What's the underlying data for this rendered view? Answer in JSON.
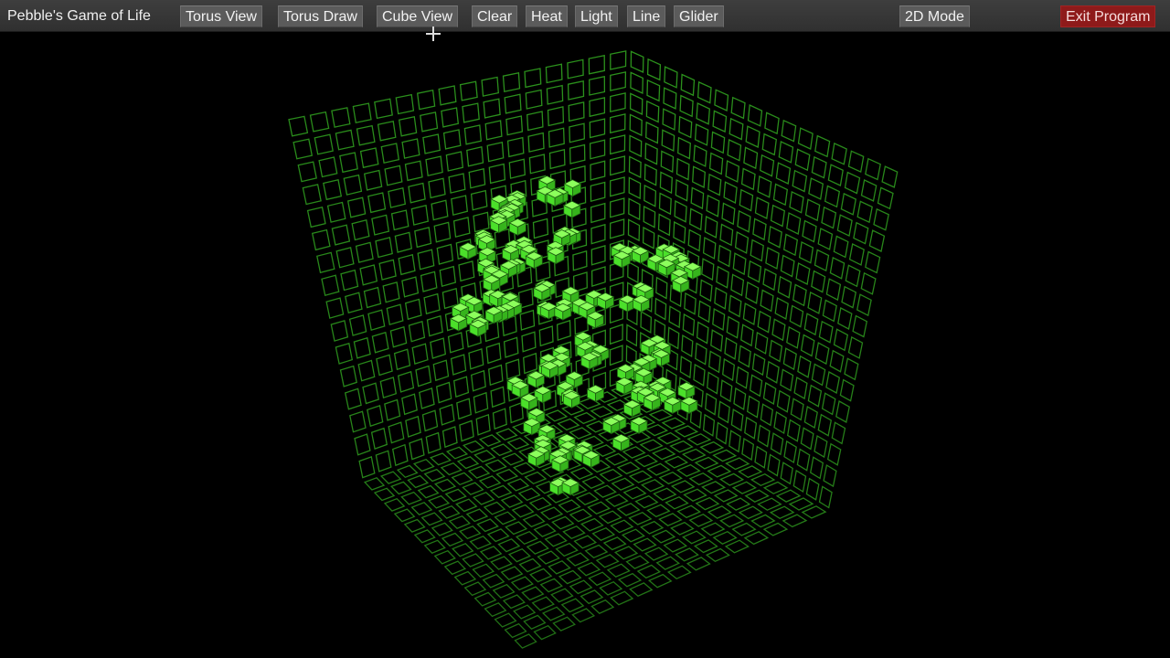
{
  "app": {
    "title": "Pebble's Game of Life"
  },
  "toolbar": {
    "buttons": [
      {
        "id": "torus-view",
        "label": "Torus View"
      },
      {
        "id": "torus-draw",
        "label": "Torus Draw"
      },
      {
        "id": "cube-view",
        "label": "Cube View"
      },
      {
        "id": "clear",
        "label": "Clear"
      },
      {
        "id": "heat",
        "label": "Heat"
      },
      {
        "id": "light",
        "label": "Light"
      },
      {
        "id": "line",
        "label": "Line"
      },
      {
        "id": "glider",
        "label": "Glider"
      },
      {
        "id": "2d-mode",
        "label": "2D Mode"
      },
      {
        "id": "exit",
        "label": "Exit Program"
      }
    ]
  },
  "scene": {
    "view": "cube",
    "grid_color": "#2e9a1e",
    "cell_color": "#4be02a",
    "background": "#000000",
    "exit_color": "#8e1a1a"
  }
}
